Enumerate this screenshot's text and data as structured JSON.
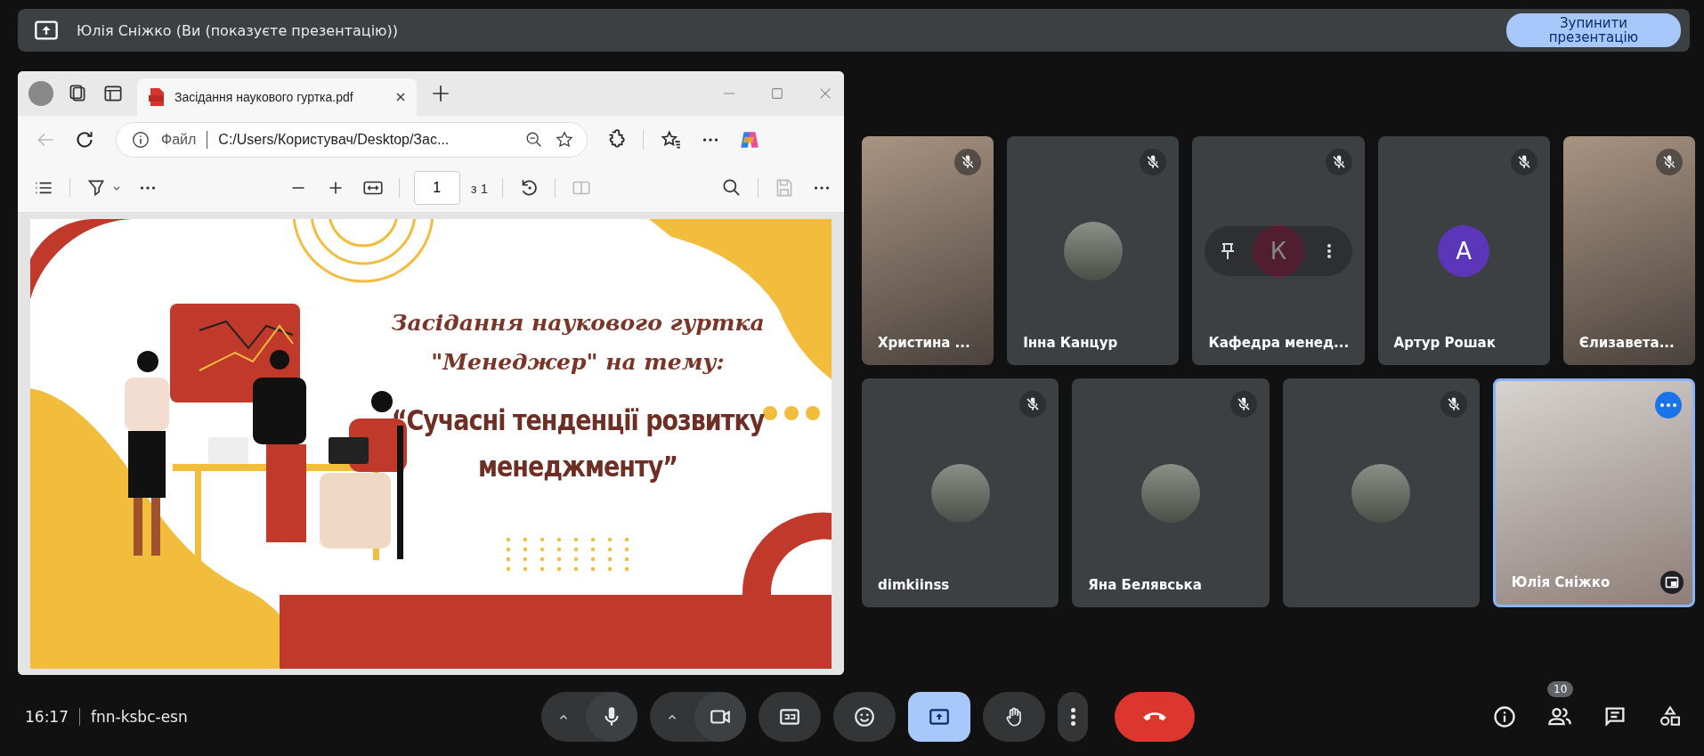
{
  "presenting_banner": {
    "text": "Юлія Сніжко (Ви (показуєте презентацію))",
    "stop_button": "Зупинити презентацію"
  },
  "browser": {
    "tab_title": "Засідання наукового гуртка.pdf",
    "address_label": "Файл",
    "address": "C:/Users/Користувач/Desktop/Зас...",
    "page_number": "1",
    "page_total": "з 1"
  },
  "slide": {
    "title_lines": [
      "Засідання наукового гуртка",
      "\"Менеджер\" на тему:"
    ],
    "subtitle_lines": [
      "“Сучасні тенденції розвитку",
      "менеджменту”"
    ]
  },
  "tile_rows": [
    [
      {
        "name": "Христина ...",
        "kind": "video",
        "muted": true,
        "self": false,
        "hovered": false
      },
      {
        "name": "Інна Канцур",
        "kind": "photo_avatar",
        "muted": true,
        "self": false,
        "hovered": false
      },
      {
        "name": "Кафедра менед...",
        "kind": "letter_avatar",
        "letter": "К",
        "color": "#8a1c3c",
        "muted": true,
        "self": false,
        "hovered": true
      },
      {
        "name": "Артур Рошак",
        "kind": "letter_avatar",
        "letter": "A",
        "color": "#5b36b8",
        "muted": true,
        "self": false,
        "hovered": false
      },
      {
        "name": "Єлизавета...",
        "kind": "video",
        "muted": true,
        "self": false,
        "hovered": false
      }
    ],
    [
      {
        "name": "dimkiinss",
        "kind": "photo_avatar",
        "muted": true,
        "self": false,
        "hovered": false
      },
      {
        "name": "Яна Белявська",
        "kind": "photo_avatar",
        "muted": true,
        "self": false,
        "hovered": false
      },
      {
        "kind": "photo_avatar",
        "muted": true,
        "self": false,
        "hovered": false
      },
      {
        "name": "Юлія Сніжко",
        "kind": "video",
        "muted": false,
        "self": true,
        "hovered": false
      }
    ]
  ],
  "bottom_bar": {
    "time": "16:17",
    "meeting_code": "fnn-ksbc-esn",
    "presenting": true,
    "people_count": "10"
  }
}
